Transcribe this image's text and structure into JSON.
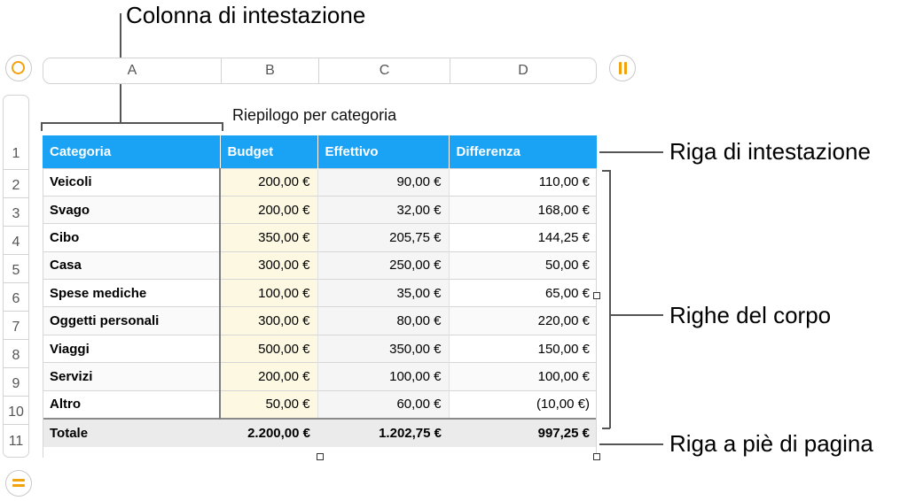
{
  "callouts": {
    "header_column": "Colonna di intestazione",
    "header_row": "Riga di intestazione",
    "body_rows": "Righe del corpo",
    "footer_row": "Riga a piè di pagina"
  },
  "column_letters": [
    "A",
    "B",
    "C",
    "D"
  ],
  "row_numbers": [
    "1",
    "2",
    "3",
    "4",
    "5",
    "6",
    "7",
    "8",
    "9",
    "10",
    "11"
  ],
  "table": {
    "title": "Riepilogo per categoria",
    "headers": [
      "Categoria",
      "Budget",
      "Effettivo",
      "Differenza"
    ],
    "rows": [
      [
        "Veicoli",
        "200,00 €",
        "90,00 €",
        "110,00 €"
      ],
      [
        "Svago",
        "200,00 €",
        "32,00 €",
        "168,00 €"
      ],
      [
        "Cibo",
        "350,00 €",
        "205,75 €",
        "144,25 €"
      ],
      [
        "Casa",
        "300,00 €",
        "250,00 €",
        "50,00 €"
      ],
      [
        "Spese mediche",
        "100,00 €",
        "35,00 €",
        "65,00 €"
      ],
      [
        "Oggetti personali",
        "300,00 €",
        "80,00 €",
        "220,00 €"
      ],
      [
        "Viaggi",
        "500,00 €",
        "350,00 €",
        "150,00 €"
      ],
      [
        "Servizi",
        "200,00 €",
        "100,00 €",
        "100,00 €"
      ],
      [
        "Altro",
        "50,00 €",
        "60,00 €",
        "(10,00 €)"
      ]
    ],
    "footer": [
      "Totale",
      "2.200,00 €",
      "1.202,75 €",
      "997,25 €"
    ]
  },
  "icons": {
    "select_table": "circle-select-icon",
    "add_column": "pause-bars-icon",
    "add_row": "equals-icon"
  },
  "colors": {
    "header_blue": "#1aa3f5",
    "accent_orange": "#f2a20c",
    "negative_red": "#e60000",
    "budget_tint": "#fdf8e2"
  }
}
